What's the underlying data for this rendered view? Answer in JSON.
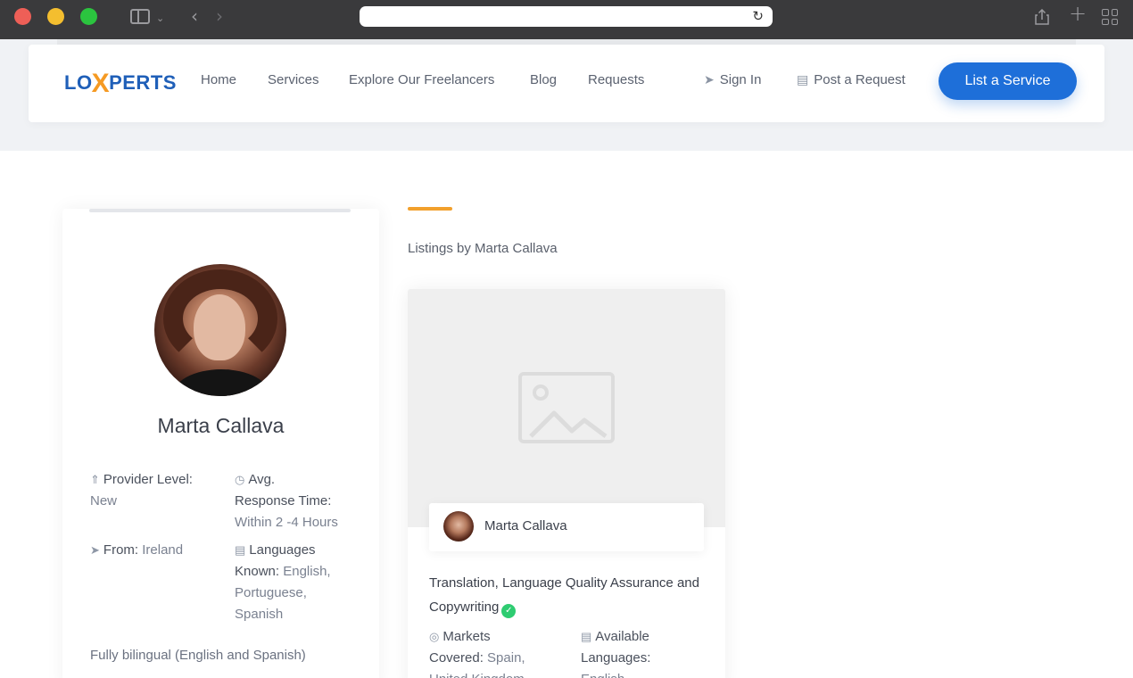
{
  "browser": {
    "url": ""
  },
  "nav": {
    "logo_left": "LO",
    "logo_x": "X",
    "logo_right": "PERTS",
    "links": [
      "Home",
      "Services",
      "Explore Our Freelancers",
      "Blog",
      "Requests"
    ],
    "sign_in": "Sign In",
    "post_request": "Post a Request",
    "cta": "List a Service"
  },
  "profile": {
    "name": "Marta Callava",
    "provider_level_label": "Provider Level:",
    "provider_level_value": "New",
    "avg_label_1": "Avg.",
    "avg_label_2": "Response Time:",
    "avg_value": "Within 2 -4 Hours",
    "from_label": "From:",
    "from_value": "Ireland",
    "languages_label_1": "Languages",
    "languages_label_2": "Known:",
    "languages_value_1": "English,",
    "languages_value_2": "Portuguese,",
    "languages_value_3": "Spanish",
    "bio": "Fully bilingual (English and Spanish)"
  },
  "listings": {
    "title": "Listings by Marta Callava",
    "items": [
      {
        "author": "Marta Callava",
        "title": "Translation, Language Quality Assurance and Copywriting",
        "markets_label_1": "Markets",
        "markets_label_2": "Covered:",
        "markets_value_1": "Spain,",
        "markets_value_2": "United Kingdom,",
        "available_label_1": "Available",
        "available_label_2": "Languages:",
        "available_value": "English,"
      }
    ]
  },
  "colors": {
    "brand_blue": "#1e6fd9",
    "accent_orange": "#f2a02c",
    "verified_green": "#2ecc71"
  }
}
